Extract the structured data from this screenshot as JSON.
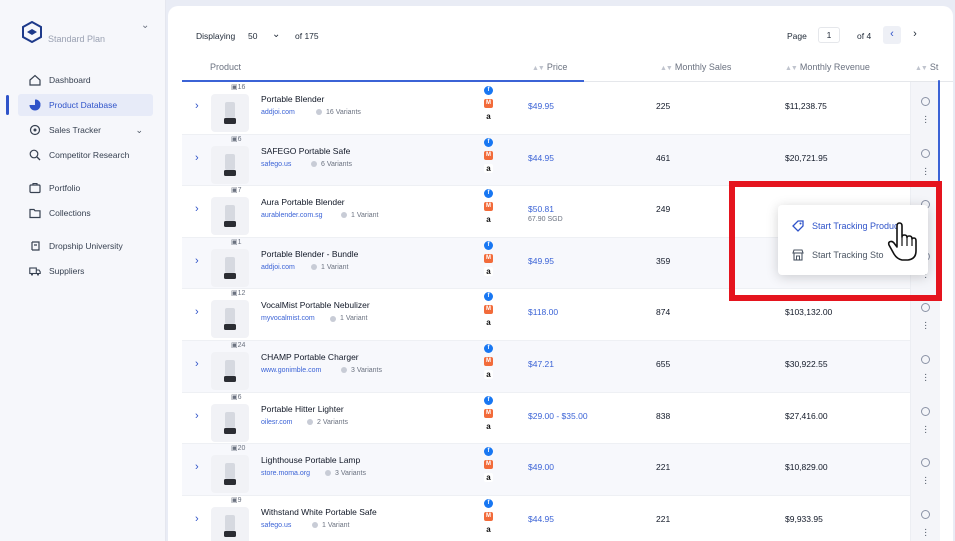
{
  "sidebar": {
    "plan": "Standard Plan",
    "items": [
      {
        "label": "Dashboard",
        "icon": "home-icon"
      },
      {
        "label": "Product Database",
        "icon": "pie-chart-icon"
      },
      {
        "label": "Sales Tracker",
        "icon": "target-icon"
      },
      {
        "label": "Competitor Research",
        "icon": "search-icon"
      },
      {
        "label": "Portfolio",
        "icon": "briefcase-icon"
      },
      {
        "label": "Collections",
        "icon": "folder-icon"
      },
      {
        "label": "Dropship University",
        "icon": "graduation-icon"
      },
      {
        "label": "Suppliers",
        "icon": "truck-icon"
      }
    ]
  },
  "topbar": {
    "displaying_label": "Displaying",
    "per_page": "50",
    "total": "of 175",
    "page_label": "Page",
    "page_value": "1",
    "page_total": "of 4"
  },
  "table": {
    "headers": [
      "Product",
      "Price",
      "Monthly Sales",
      "Monthly Revenue",
      "St"
    ],
    "rows": [
      {
        "badge": "16",
        "name": "Portable Blender",
        "domain": "addjoi.com",
        "variants": "16 Variants",
        "price": "$49.95",
        "price2": "",
        "sales": "225",
        "revenue": "$11,238.75"
      },
      {
        "badge": "6",
        "name": "SAFEGO Portable Safe",
        "domain": "safego.us",
        "variants": "6 Variants",
        "price": "$44.95",
        "price2": "",
        "sales": "461",
        "revenue": "$20,721.95"
      },
      {
        "badge": "7",
        "name": "Aura Portable Blender",
        "domain": "aurablender.com.sg",
        "variants": "1 Variant",
        "price": "$50.81",
        "price2": "67.90 SGD",
        "sales": "249",
        "revenue": ""
      },
      {
        "badge": "1",
        "name": "Portable Blender - Bundle",
        "domain": "addjoi.com",
        "variants": "1 Variant",
        "price": "$49.95",
        "price2": "",
        "sales": "359",
        "revenue": ""
      },
      {
        "badge": "12",
        "name": "VocalMist Portable Nebulizer",
        "domain": "myvocalmist.com",
        "variants": "1 Variant",
        "price": "$118.00",
        "price2": "",
        "sales": "874",
        "revenue": "$103,132.00"
      },
      {
        "badge": "24",
        "name": "CHAMP Portable Charger",
        "domain": "www.gonimble.com",
        "variants": "3 Variants",
        "price": "$47.21",
        "price2": "",
        "sales": "655",
        "revenue": "$30,922.55"
      },
      {
        "badge": "6",
        "name": "Portable Hitter Lighter",
        "domain": "oilesr.com",
        "variants": "2 Variants",
        "price": "$29.00 - $35.00",
        "price2": "",
        "sales": "838",
        "revenue": "$27,416.00"
      },
      {
        "badge": "20",
        "name": "Lighthouse Portable Lamp",
        "domain": "store.moma.org",
        "variants": "3 Variants",
        "price": "$49.00",
        "price2": "",
        "sales": "221",
        "revenue": "$10,829.00"
      },
      {
        "badge": "9",
        "name": "Withstand White Portable Safe",
        "domain": "safego.us",
        "variants": "1 Variant",
        "price": "$44.95",
        "price2": "",
        "sales": "221",
        "revenue": "$9,933.95"
      }
    ]
  },
  "popup": {
    "track_product": "Start Tracking Product",
    "track_store": "Start Tracking Sto"
  },
  "colors": {
    "accent": "#2f53c9",
    "highlight": "#e5141e"
  }
}
